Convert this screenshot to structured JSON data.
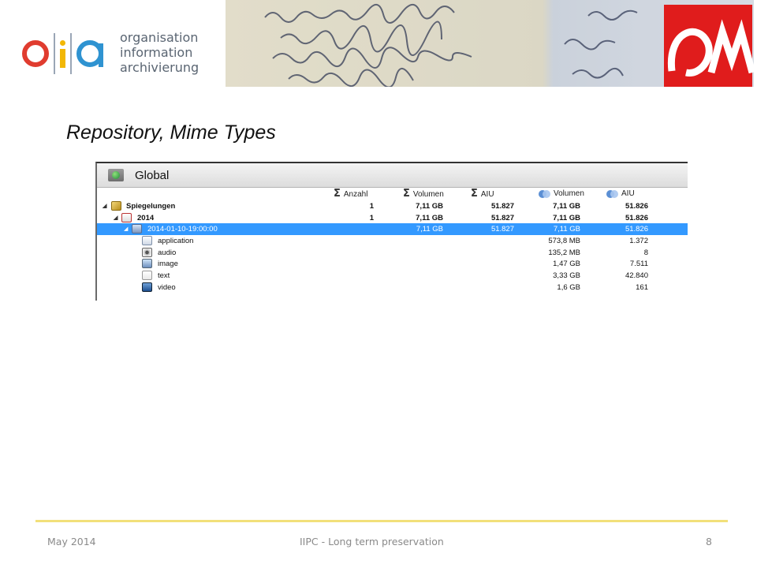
{
  "header": {
    "logo_lines": [
      "organisation",
      "information",
      "archivierung"
    ]
  },
  "slide": {
    "title": "Repository,  Mime Types"
  },
  "panel": {
    "title": "Global",
    "columns": [
      {
        "label": "Anzahl",
        "icon": "sigma-icon"
      },
      {
        "label": "Volumen",
        "icon": "sigma-icon"
      },
      {
        "label": "AIU",
        "icon": "sigma-icon"
      },
      {
        "label": "Volumen",
        "icon": "intersect-icon"
      },
      {
        "label": "AIU",
        "icon": "intersect-icon"
      }
    ],
    "rows": [
      {
        "label": "Spiegelungen",
        "icon": "cube-icon",
        "expanded": true,
        "bold": true,
        "cells": [
          "1",
          "7,11 GB",
          "51.827",
          "7,11 GB",
          "51.826"
        ]
      },
      {
        "label": "2014",
        "icon": "calendar-icon",
        "expanded": true,
        "bold": true,
        "cells": [
          "1",
          "7,11 GB",
          "51.827",
          "7,11 GB",
          "51.826"
        ]
      },
      {
        "label": "2014-01-10-19:00:00",
        "icon": "database-icon",
        "expanded": true,
        "selected": true,
        "cells": [
          "",
          "7,11 GB",
          "51.827",
          "7,11 GB",
          "51.826"
        ]
      },
      {
        "label": "application",
        "icon": "application-icon",
        "cells": [
          "",
          "",
          "",
          "573,8 MB",
          "1.372"
        ]
      },
      {
        "label": "audio",
        "icon": "audio-icon",
        "cells": [
          "",
          "",
          "",
          "135,2 MB",
          "8"
        ]
      },
      {
        "label": "image",
        "icon": "image-icon",
        "cells": [
          "",
          "",
          "",
          "1,47 GB",
          "7.511"
        ]
      },
      {
        "label": "text",
        "icon": "text-icon",
        "cells": [
          "",
          "",
          "",
          "3,33 GB",
          "42.840"
        ]
      },
      {
        "label": "video",
        "icon": "video-icon",
        "cells": [
          "",
          "",
          "",
          "1,6 GB",
          "161"
        ]
      }
    ]
  },
  "footer": {
    "date": "May  2014",
    "center": "IIPC - Long term preservation",
    "page": "8"
  },
  "colors": {
    "accent_red": "#e03c2f",
    "accent_yellow": "#f2b705",
    "accent_blue": "#2f93d1",
    "selection": "#3399ff",
    "footer_rule": "#f2e07a"
  }
}
